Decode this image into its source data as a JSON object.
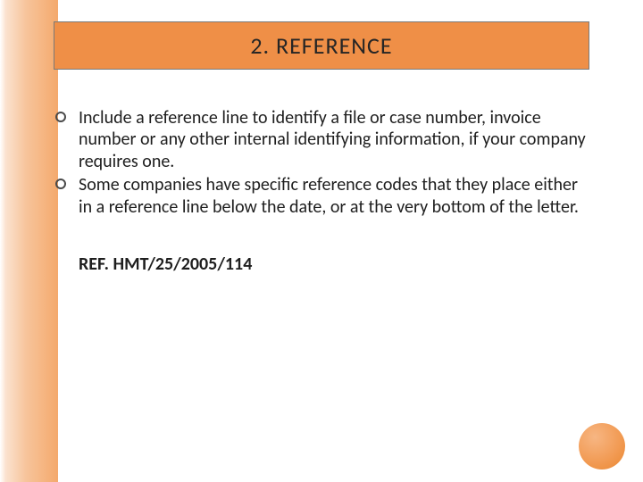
{
  "title": "2.  REFERENCE",
  "bullets": [
    "Include a reference line to identify a file or case number, invoice number or any other internal identifying information, if your company requires one.",
    "Some companies have specific reference codes that they place either in a reference line below the date, or at the very bottom of the letter."
  ],
  "reference_code": "REF. HMT/25/2005/114"
}
